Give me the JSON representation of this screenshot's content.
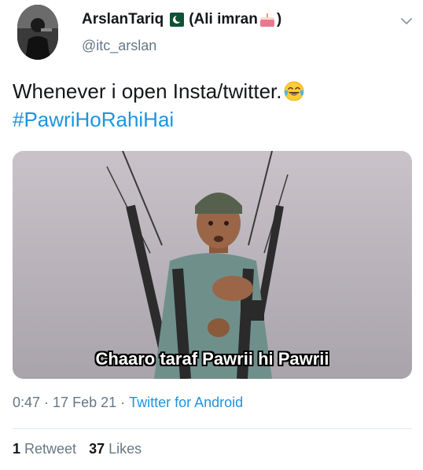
{
  "tweet": {
    "author": {
      "display_name": "ArslanTariq",
      "name_suffix": "(Ali imran",
      "name_close": ")",
      "handle": "@itc_arslan",
      "flag_icon": "pakistan-flag-icon",
      "cake_icon": "birthday-cake-icon"
    },
    "text_line_1": "Whenever i open Insta/twitter.",
    "emoji_icon": "face-with-tears-of-joy-icon",
    "hashtag": "#PawriHoRahiHai",
    "media": {
      "caption": "Chaaro taraf Pawrii hi Pawrii"
    },
    "meta": {
      "time": "0:47",
      "separator": "·",
      "date": "17 Feb 21",
      "source": "Twitter for Android"
    },
    "stats": {
      "retweets_count": "1",
      "retweets_label": "Retweet",
      "likes_count": "37",
      "likes_label": "Likes"
    },
    "colors": {
      "link": "#1b95e0",
      "muted": "#657786",
      "text": "#14171a"
    }
  }
}
